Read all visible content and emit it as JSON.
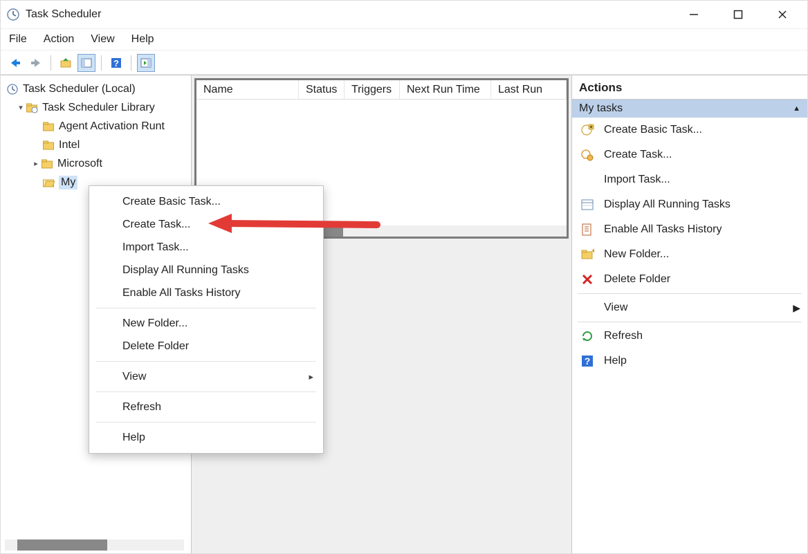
{
  "window": {
    "title": "Task Scheduler"
  },
  "menubar": {
    "file": "File",
    "action": "Action",
    "view": "View",
    "help": "Help"
  },
  "tree": {
    "root": "Task Scheduler (Local)",
    "library": "Task Scheduler Library",
    "items": [
      {
        "label": "Agent Activation Runt",
        "expandable": false
      },
      {
        "label": "Intel",
        "expandable": false
      },
      {
        "label": "Microsoft",
        "expandable": true
      },
      {
        "label": "My tasks",
        "expandable": false,
        "selected": true,
        "display": "My "
      }
    ]
  },
  "task_list": {
    "columns": [
      "Name",
      "Status",
      "Triggers",
      "Next Run Time",
      "Last Run "
    ]
  },
  "actions_pane": {
    "title": "Actions",
    "context_label": "My tasks",
    "items": [
      {
        "label": "Create Basic Task...",
        "icon": "clock-new"
      },
      {
        "label": "Create Task...",
        "icon": "clock-gear"
      },
      {
        "label": "Import Task...",
        "icon": "import"
      },
      {
        "label": "Display All Running Tasks",
        "icon": "running-tasks"
      },
      {
        "label": "Enable All Tasks History",
        "icon": "history"
      },
      {
        "label": "New Folder...",
        "icon": "new-folder"
      },
      {
        "label": "Delete Folder",
        "icon": "delete"
      },
      {
        "sep": true
      },
      {
        "label": "View",
        "icon": "blank",
        "submenu": true
      },
      {
        "sep": true
      },
      {
        "label": "Refresh",
        "icon": "refresh"
      },
      {
        "label": "Help",
        "icon": "help"
      }
    ]
  },
  "context_menu": {
    "groups": [
      [
        "Create Basic Task...",
        "Create Task...",
        "Import Task...",
        "Display All Running Tasks",
        "Enable All Tasks History"
      ],
      [
        "New Folder...",
        "Delete Folder"
      ],
      [
        "View"
      ],
      [
        "Refresh"
      ],
      [
        "Help"
      ]
    ],
    "submenu_items": [
      "View"
    ]
  }
}
